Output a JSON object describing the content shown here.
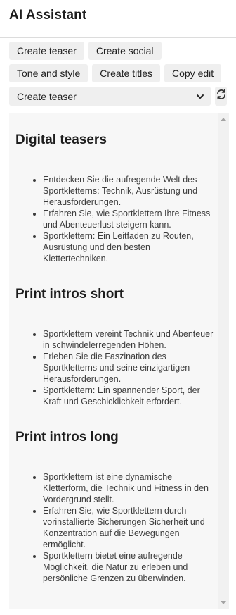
{
  "header": {
    "title": "AI Assistant"
  },
  "toolbar": {
    "row1": [
      "Create teaser",
      "Create social"
    ],
    "row2": [
      "Tone and style",
      "Create titles",
      "Copy edit"
    ],
    "select_value": "Create teaser",
    "refresh_icon": "refresh-icon",
    "chevron_icon": "chevron-down-icon"
  },
  "sections": [
    {
      "title": "Digital teasers",
      "items": [
        "Entdecken Sie die aufregende Welt des Sportkletterns: Technik, Ausrüstung und Herausforderungen.",
        "Erfahren Sie, wie Sportklettern Ihre Fitness und Abenteuerlust steigern kann.",
        "Sportklettern: Ein Leitfaden zu Routen, Ausrüstung und den besten Klettertechniken."
      ]
    },
    {
      "title": "Print intros short",
      "items": [
        "Sportklettern vereint Technik und Abenteuer in schwindelerregenden Höhen.",
        "Erleben Sie die Faszination des Sportkletterns und seine einzigartigen Herausforderungen.",
        "Sportklettern: Ein spannender Sport, der Kraft und Geschicklichkeit erfordert."
      ]
    },
    {
      "title": "Print intros long",
      "items": [
        "Sportklettern ist eine dynamische Kletterform, die Technik und Fitness in den Vordergrund stellt.",
        "Erfahren Sie, wie Sportklettern durch vorinstallierte Sicherungen Sicherheit und Konzentration auf die Bewegungen ermöglicht.",
        "Sportklettern bietet eine aufregende Möglichkeit, die Natur zu erleben und persönliche Grenzen zu überwinden."
      ]
    }
  ]
}
